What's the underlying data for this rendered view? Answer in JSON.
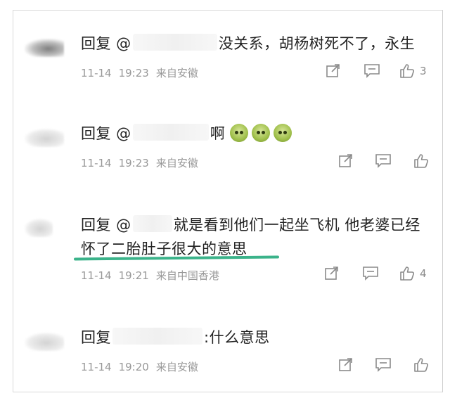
{
  "comments": [
    {
      "reply_prefix": "回复 @",
      "text": "没关系，胡杨树死不了，永生",
      "date": "11-14",
      "time": "19:23",
      "location": "来自安徽",
      "likes": "3"
    },
    {
      "reply_prefix": "回复 @",
      "text": "啊",
      "emoji_count": 3,
      "date": "11-14",
      "time": "19:23",
      "location": "来自安徽",
      "likes": ""
    },
    {
      "reply_prefix": "回复 @",
      "text_line1": "就是看到他们一起坐飞机 他老婆已经",
      "text_line2": "怀了二胎肚子很大的意思",
      "date": "11-14",
      "time": "19:21",
      "location": "来自中国香港",
      "likes": "4"
    },
    {
      "reply_prefix": "回复",
      "text": ":什么意思",
      "date": "11-14",
      "time": "19:20",
      "location": "来自安徽",
      "likes": ""
    }
  ],
  "highlight_color": "#3bb38a"
}
